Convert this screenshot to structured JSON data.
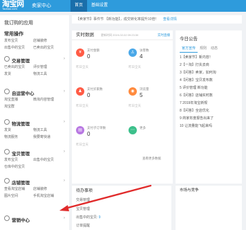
{
  "brand": {
    "name": "淘宝网",
    "domain": "Taobao.com",
    "section": "卖家中心"
  },
  "topnav": [
    "首页",
    "基础设置",
    "",
    ""
  ],
  "sidebar": {
    "title": "我订购的应用",
    "common_ops": {
      "title": "常用操作",
      "links": [
        "发布宝贝",
        "店铺装修",
        "出售中的宝贝",
        "已卖出的宝贝"
      ]
    },
    "groups": [
      {
        "name": "交易管理",
        "links": [
          "已卖出的宝贝",
          "评价管理",
          "发货",
          "物流工具"
        ]
      },
      {
        "name": "自运营中心",
        "links": [
          "淘宝直播",
          "微淘内容管理",
          "淘宝群"
        ]
      },
      {
        "name": "物流管理",
        "links": [
          "发货",
          "物流工具",
          "物流服务",
          "我要寄快递"
        ]
      },
      {
        "name": "宝贝管理",
        "links": [
          "发布宝贝",
          "出售中的宝贝",
          "仓库中的宝贝"
        ]
      },
      {
        "name": "店铺管理",
        "links": [
          "查看淘宝店铺",
          "店铺装修",
          "图片空间",
          "手机淘宝店铺"
        ]
      },
      {
        "name": "营销中心",
        "links": []
      }
    ]
  },
  "notice": {
    "text": "【卖家节】事件节 【新功能】，成交转化率提升10倍！",
    "link": "查看详情"
  },
  "realtime": {
    "title": "实时数据",
    "timestamp": "更新时间 2019-02-02 09:23:30",
    "link": "实时直播",
    "stats": [
      {
        "label": "支付金额",
        "value": "0",
        "compare": "昨日全天",
        "color": "#ff5b45",
        "icon": "yen-icon"
      },
      {
        "label": "访客数",
        "value": "4",
        "compare": "昨日全天",
        "color": "#4aa8e8",
        "icon": "user-icon"
      },
      {
        "label": "支付买家数",
        "value": "0",
        "compare": "昨日全天",
        "color": "#ff5b45",
        "icon": "buyer-icon"
      },
      {
        "label": "浏览量",
        "value": "5",
        "compare": "昨日全天",
        "color": "#ff8a3d",
        "icon": "eye-icon"
      },
      {
        "label": "支付子订单数",
        "value": "0",
        "compare": "昨日全天",
        "color": "#b878e2",
        "icon": "order-icon"
      },
      {
        "label": "更多",
        "value": "",
        "compare": "",
        "color": "#3cc08b",
        "icon": "more-icon"
      }
    ],
    "more_board": "查看更多数据"
  },
  "today": {
    "title": "今日公告",
    "tabs": [
      "官方宣传",
      "规则",
      "动态"
    ],
    "news": [
      "1【卖家节】新内容！",
      "2【一淘】打失去商",
      "3【问答】卖家，如何淘",
      "4【问答】宝贝发布数",
      "5 评价管理 新功能",
      "6【问答】店铺实时数",
      "7 2019年淘宝新规",
      "8【问答】全店优化",
      "9 商家年度报告出来了",
      "10 让流量能飞起来吗"
    ]
  },
  "todo": {
    "title": "待办事项",
    "items": [
      {
        "label": "交易管理",
        "count": ""
      },
      {
        "label": "宝贝管理",
        "count": ""
      },
      {
        "label": "出售中的宝贝: ",
        "count": "9"
      },
      {
        "label": "订单提醒",
        "count": ""
      }
    ]
  },
  "market": {
    "title": "市场与竞争"
  }
}
